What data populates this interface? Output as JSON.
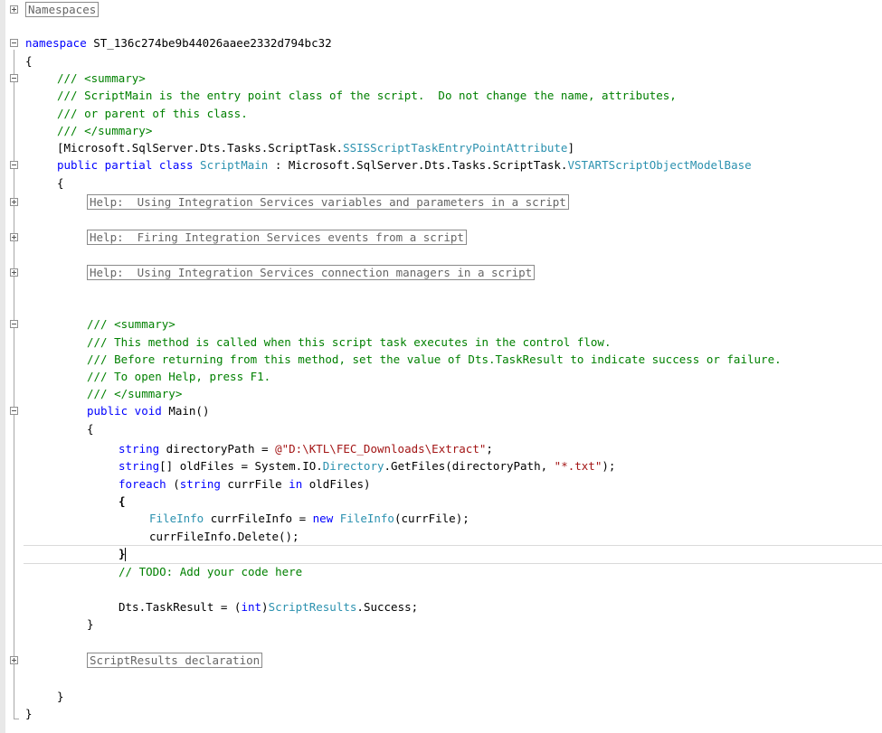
{
  "colors": {
    "keyword": "#0000ff",
    "type": "#2b91af",
    "comment": "#008000",
    "doc_tag": "#808080",
    "string": "#a31515"
  },
  "code": {
    "namespaces_region": "Namespaces",
    "ns_kw": "namespace",
    "ns_name": " ST_136c274be9b44026aaee2332d794bc32",
    "brace_open": "{",
    "brace_close": "}",
    "doc1_open": "/// <summary>",
    "doc1_l1": "/// ScriptMain is the entry point class of the script.  Do not change the name, attributes,",
    "doc1_l2": "/// or parent of this class.",
    "doc1_close": "/// </summary>",
    "attr_prefix": "[Microsoft.SqlServer.Dts.Tasks.ScriptTask.",
    "attr_type": "SSISScriptTaskEntryPointAttribute",
    "attr_suffix": "]",
    "class_kw": "public partial class",
    "class_name": "ScriptMain",
    "class_mid": " : Microsoft.SqlServer.Dts.Tasks.ScriptTask.",
    "class_base": "VSTARTScriptObjectModelBase",
    "region_help1": "Help:  Using Integration Services variables and parameters in a script",
    "region_help2": "Help:  Firing Integration Services events from a script",
    "region_help3": "Help:  Using Integration Services connection managers in a script",
    "doc2_open": "/// <summary>",
    "doc2_l1": "/// This method is called when this script task executes in the control flow.",
    "doc2_l2": "/// Before returning from this method, set the value of Dts.TaskResult to indicate success or failure.",
    "doc2_l3": "/// To open Help, press F1.",
    "doc2_close": "/// </summary>",
    "main_kw": "public void",
    "main_name": " Main()",
    "s1_kw": "string",
    "s1_mid": " directoryPath = ",
    "s1_str": "@\"D:\\KTL\\FEC_Downloads\\Extract\"",
    "s1_end": ";",
    "s2_kw": "string",
    "s2_mid": "[] oldFiles = System.IO.",
    "s2_type": "Directory",
    "s2_call": ".GetFiles(directoryPath, ",
    "s2_str": "\"*.txt\"",
    "s2_end": ");",
    "s3_kw": "foreach",
    "s3_p1": " (",
    "s3_kw2": "string",
    "s3_mid": " currFile ",
    "s3_kw3": "in",
    "s3_end": " oldFiles)",
    "s4_type": "FileInfo",
    "s4_mid": " currFileInfo = ",
    "s4_kw": "new",
    "s4_type2": "FileInfo",
    "s4_end": "(currFile);",
    "s5": "currFileInfo.Delete();",
    "todo": "// TODO: Add your code here",
    "ret_pre": "Dts.TaskResult = (",
    "ret_kw": "int",
    "ret_mid": ")",
    "ret_type": "ScriptResults",
    "ret_end": ".Success;",
    "region_results": "ScriptResults declaration"
  }
}
